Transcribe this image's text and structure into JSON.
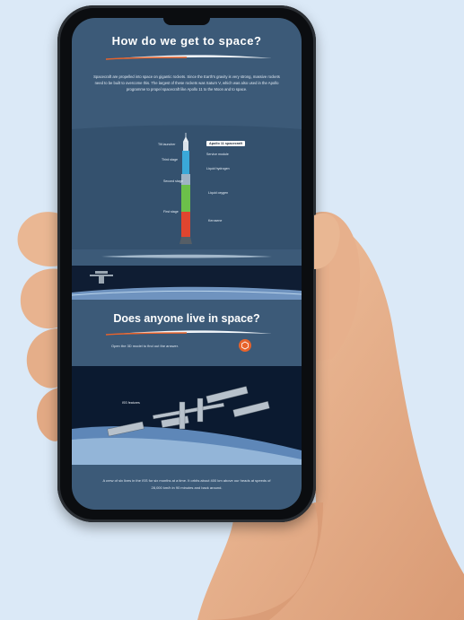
{
  "page": {
    "heading_1": "How do we get to space?",
    "intro": "Spacecraft are propelled into space on gigantic rockets. Since the Earth's gravity is very strong, massive rockets need to be built to overcome this. The largest of these rockets was Saturn V, which was also used in the Apollo programme to propel spacecraft like Apollo 11 to the Moon and to space.",
    "heading_2": "Does anyone live in space?",
    "cta_text": "Open the 3D model to find out the answer.",
    "iss_label": "ISS features",
    "outro": "A crew of six lives in the ISS for six months at a time. It orbits about 400 km above our heads at speeds of 28,000 km/h in 90 minutes and back around."
  },
  "rocket": {
    "top_label": "Apollo 11 spacecraft",
    "labels_left": [
      "Tilt launcher",
      "Third stage",
      "Second stage",
      "First stage"
    ],
    "labels_right": [
      "Service module",
      "Liquid hydrogen",
      "Liquid oxygen",
      "Kerosene"
    ]
  },
  "colors": {
    "screen_bg": "#3c5a78",
    "accent": "#e8632b",
    "rocket_third": "#3aa8d8",
    "rocket_second": "#6cc04a",
    "rocket_first": "#e0452f"
  }
}
